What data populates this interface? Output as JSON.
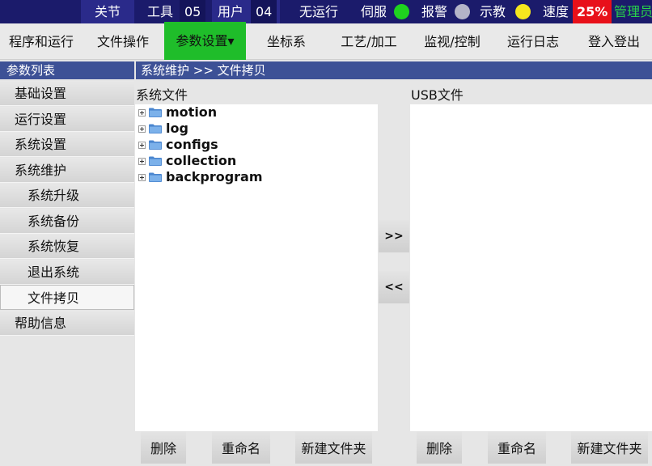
{
  "status_bar": {
    "module": "关节",
    "tool_label": "工具",
    "tool_value": "05",
    "user_label": "用户",
    "user_value": "04",
    "run_state": "无运行",
    "servo_label": "伺服",
    "alarm_label": "报警",
    "teach_label": "示教",
    "speed_label": "速度",
    "speed_value": "25%",
    "role": "管理员",
    "servo_color": "#1fd21f",
    "alarm_color": "#b4b4c8",
    "teach_color": "#f5e61e"
  },
  "menu": {
    "items": [
      {
        "label": "程序和运行"
      },
      {
        "label": "文件操作"
      },
      {
        "label": "参数设置▾"
      },
      {
        "label": "坐标系"
      },
      {
        "label": "工艺/加工"
      },
      {
        "label": "监视/控制"
      },
      {
        "label": "运行日志"
      },
      {
        "label": "登入登出"
      }
    ],
    "active_index": 2,
    "active_color": "#1fbd2a"
  },
  "sidebar": {
    "header": "参数列表",
    "items": [
      {
        "label": "基础设置",
        "level": 0
      },
      {
        "label": "运行设置",
        "level": 0
      },
      {
        "label": "系统设置",
        "level": 0
      },
      {
        "label": "系统维护",
        "level": 0
      },
      {
        "label": "系统升级",
        "level": 1
      },
      {
        "label": "系统备份",
        "level": 1
      },
      {
        "label": "系统恢复",
        "level": 1
      },
      {
        "label": "退出系统",
        "level": 1
      },
      {
        "label": "文件拷贝",
        "level": 1
      },
      {
        "label": "帮助信息",
        "level": 0
      }
    ],
    "selected_index": 8
  },
  "breadcrumb": "系统维护 >> 文件拷贝",
  "system_files": {
    "title": "系统文件",
    "items": [
      "motion",
      "log",
      "configs",
      "collection",
      "backprogram"
    ],
    "buttons": {
      "delete": "删除",
      "rename": "重命名",
      "new_folder": "新建文件夹"
    }
  },
  "usb_files": {
    "title": "USB文件",
    "items": [],
    "buttons": {
      "delete": "删除",
      "rename": "重命名",
      "new_folder": "新建文件夹"
    }
  },
  "transfer": {
    "to_usb": ">>",
    "to_system": "<<"
  },
  "colors": {
    "header_blue": "#3d5196",
    "status_bg": "#1b1b6b",
    "speed_red": "#e8101a",
    "role_green": "#28d24a"
  }
}
